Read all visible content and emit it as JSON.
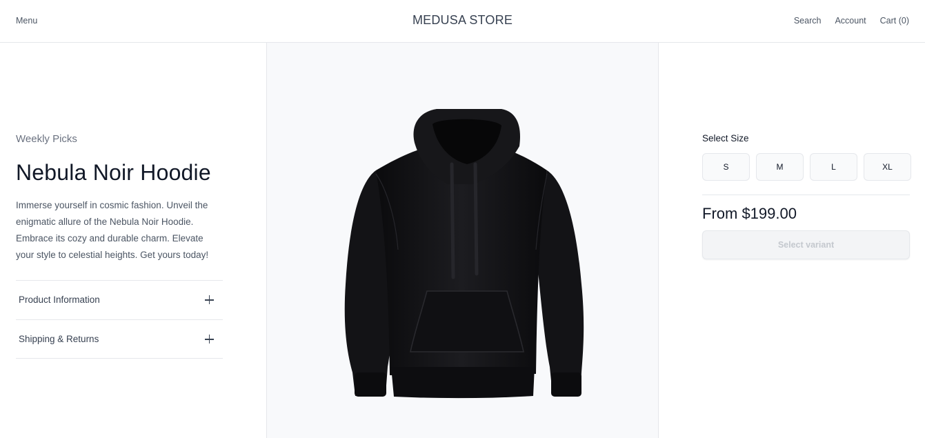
{
  "header": {
    "menu_label": "Menu",
    "brand": "MEDUSA STORE",
    "search_label": "Search",
    "account_label": "Account",
    "cart_label": "Cart (0)"
  },
  "product": {
    "collection": "Weekly Picks",
    "title": "Nebula Noir Hoodie",
    "description": "Immerse yourself in cosmic fashion. Unveil the enigmatic allure of the Nebula Noir Hoodie. Embrace its cozy and durable charm. Elevate your style to celestial heights. Get yours today!",
    "accordions": [
      {
        "label": "Product Information",
        "icon": "plus-icon"
      },
      {
        "label": "Shipping & Returns",
        "icon": "plus-icon"
      }
    ],
    "image": {
      "subject": "black hoodie",
      "background": "#f8f9fb"
    }
  },
  "purchase": {
    "size_label": "Select Size",
    "sizes": [
      "S",
      "M",
      "L",
      "XL"
    ],
    "price": "From $199.00",
    "cta_label": "Select variant",
    "cta_disabled": true
  },
  "colors": {
    "text": "#111827",
    "muted": "#6b7280",
    "border": "#e5e7eb",
    "image_bg": "#f8f9fb",
    "disabled_text": "#c4c8ce"
  }
}
